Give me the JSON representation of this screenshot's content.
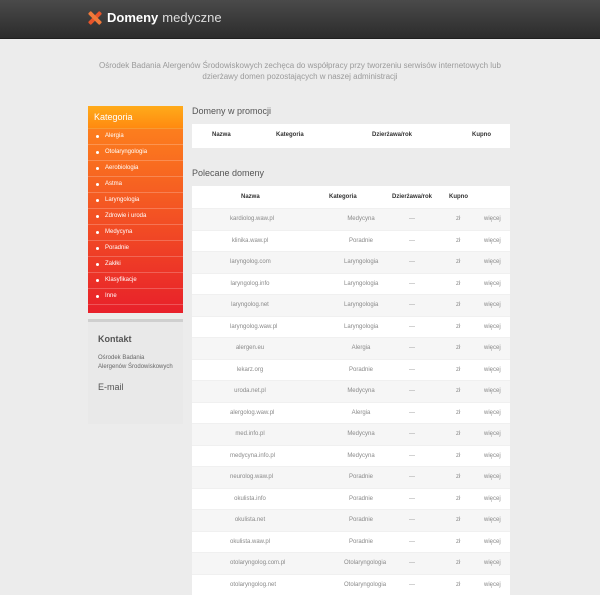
{
  "header": {
    "title": "Domeny",
    "subtitle": "medyczne"
  },
  "intro": "Ośrodek Badania Alergenów Środowiskowych zechęca do współpracy przy tworzeniu serwisów internetowych lub dzierżawy domen pozostających w naszej administracji",
  "sidebar": {
    "category_title": "Kategoria",
    "categories": [
      "Alergia",
      "Otolaryngologia",
      "Aerobiologia",
      "Astma",
      "Laryngologia",
      "Zdrowie i uroda",
      "Medycyna",
      "Poradnie",
      "Zakłki",
      "Klasyfikacje",
      "Inne"
    ],
    "contact": {
      "title": "Kontakt",
      "text": "Ośrodek Badania Alergenów Środowiskowych",
      "email_label": "E-mail"
    }
  },
  "promo": {
    "title": "Domeny w promocji",
    "headers": {
      "nazwa": "Nazwa",
      "kategoria": "Kategoria",
      "dzierzawa": "Dzierżawa/rok",
      "kupno": "Kupno"
    }
  },
  "featured": {
    "title": "Polecane domeny",
    "headers": {
      "nazwa": "Nazwa",
      "kategoria": "Kategoria",
      "dzierzawa": "Dzierżawa/rok",
      "kupno": "Kupno"
    },
    "rows": [
      {
        "nazwa": "kardiolog.waw.pl",
        "kategoria": "Medycyna",
        "dzierzawa": "---",
        "kupno": "zł",
        "more": "więcej"
      },
      {
        "nazwa": "klinika.waw.pl",
        "kategoria": "Poradnie",
        "dzierzawa": "---",
        "kupno": "zł",
        "more": "więcej"
      },
      {
        "nazwa": "laryngolog.com",
        "kategoria": "Laryngologia",
        "dzierzawa": "---",
        "kupno": "zł",
        "more": "więcej"
      },
      {
        "nazwa": "laryngolog.info",
        "kategoria": "Laryngologia",
        "dzierzawa": "---",
        "kupno": "zł",
        "more": "więcej"
      },
      {
        "nazwa": "laryngolog.net",
        "kategoria": "Laryngologia",
        "dzierzawa": "---",
        "kupno": "zł",
        "more": "więcej"
      },
      {
        "nazwa": "laryngolog.waw.pl",
        "kategoria": "Laryngologia",
        "dzierzawa": "---",
        "kupno": "zł",
        "more": "więcej"
      },
      {
        "nazwa": "alergen.eu",
        "kategoria": "Alergia",
        "dzierzawa": "---",
        "kupno": "zł",
        "more": "więcej"
      },
      {
        "nazwa": "lekarz.org",
        "kategoria": "Poradnie",
        "dzierzawa": "---",
        "kupno": "zł",
        "more": "więcej"
      },
      {
        "nazwa": "uroda.net.pl",
        "kategoria": "Medycyna",
        "dzierzawa": "---",
        "kupno": "zł",
        "more": "więcej"
      },
      {
        "nazwa": "alergolog.waw.pl",
        "kategoria": "Alergia",
        "dzierzawa": "---",
        "kupno": "zł",
        "more": "więcej"
      },
      {
        "nazwa": "med.info.pl",
        "kategoria": "Medycyna",
        "dzierzawa": "---",
        "kupno": "zł",
        "more": "więcej"
      },
      {
        "nazwa": "medycyna.info.pl",
        "kategoria": "Medycyna",
        "dzierzawa": "---",
        "kupno": "zł",
        "more": "więcej"
      },
      {
        "nazwa": "neurolog.waw.pl",
        "kategoria": "Poradnie",
        "dzierzawa": "---",
        "kupno": "zł",
        "more": "więcej"
      },
      {
        "nazwa": "okulista.info",
        "kategoria": "Poradnie",
        "dzierzawa": "---",
        "kupno": "zł",
        "more": "więcej"
      },
      {
        "nazwa": "okulista.net",
        "kategoria": "Poradnie",
        "dzierzawa": "---",
        "kupno": "zł",
        "more": "więcej"
      },
      {
        "nazwa": "okulista.waw.pl",
        "kategoria": "Poradnie",
        "dzierzawa": "---",
        "kupno": "zł",
        "more": "więcej"
      },
      {
        "nazwa": "otolaryngolog.com.pl",
        "kategoria": "Otolaryngologia",
        "dzierzawa": "---",
        "kupno": "zł",
        "more": "więcej"
      },
      {
        "nazwa": "otolaryngolog.net",
        "kategoria": "Otolaryngologia",
        "dzierzawa": "---",
        "kupno": "zł",
        "more": "więcej"
      }
    ]
  },
  "colors": {
    "accent_top": "#ffab1a",
    "accent_bottom": "#e8202a",
    "header_bg": "#333333"
  }
}
